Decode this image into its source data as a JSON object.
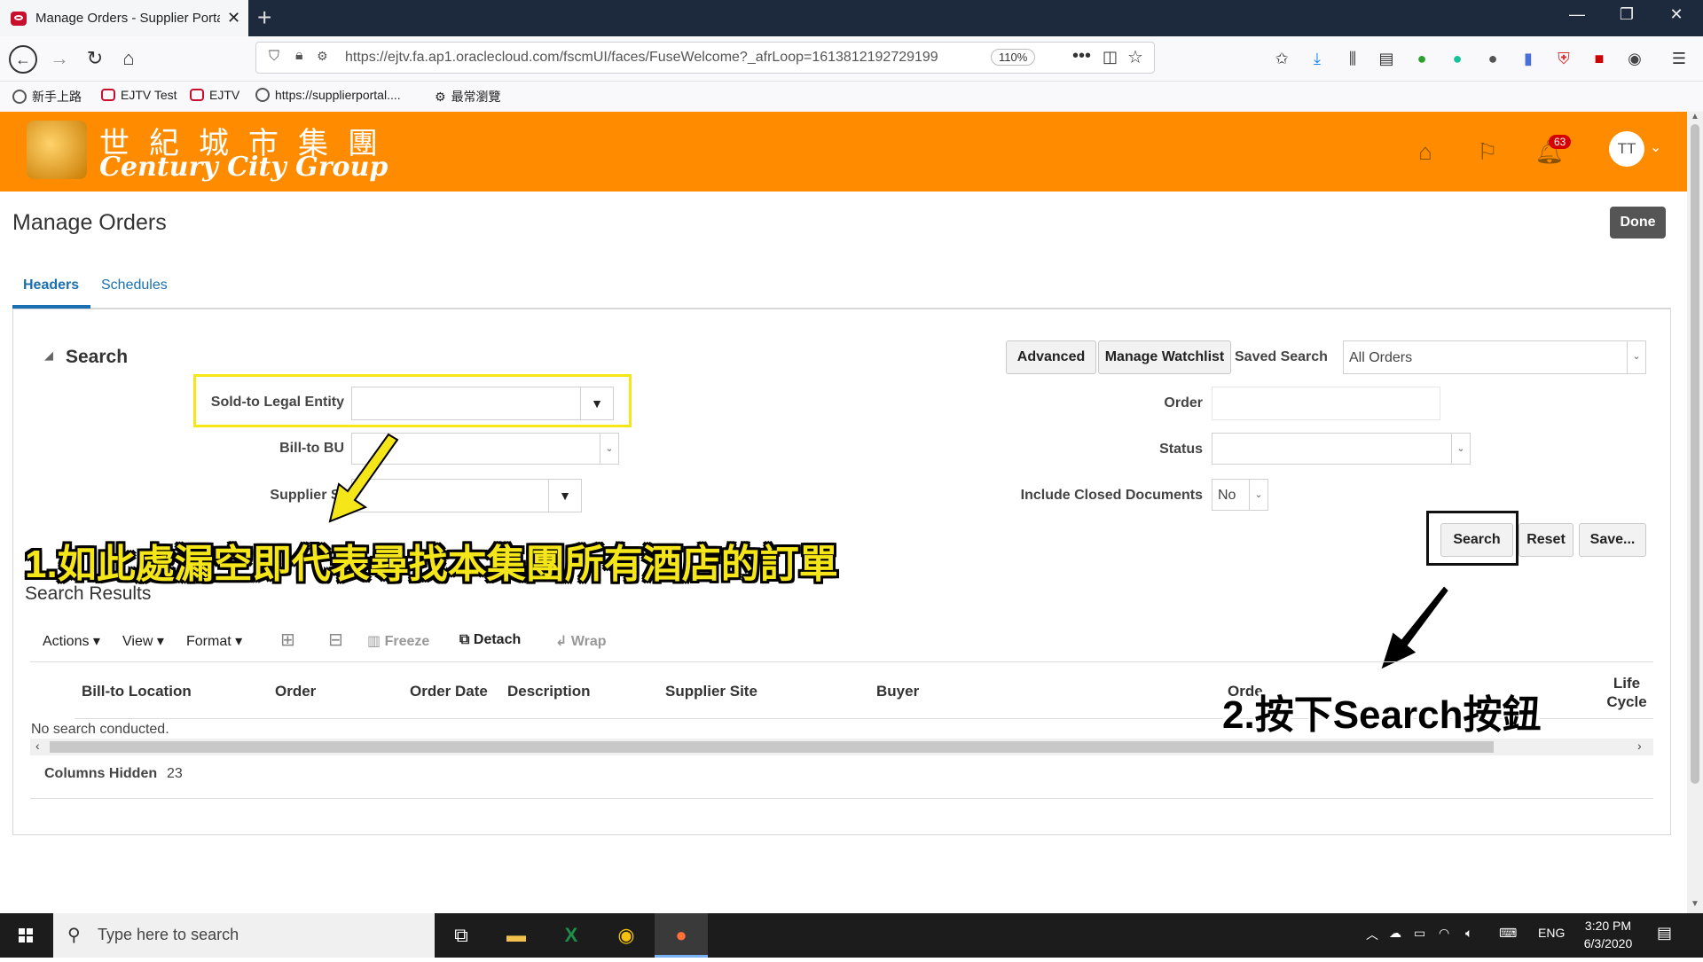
{
  "browser": {
    "tab_title": "Manage Orders - Supplier Porta",
    "url": "https://ejtv.fa.ap1.oraclecloud.com/fscmUI/faces/FuseWelcome?_afrLoop=1613812192729199",
    "zoom": "110%",
    "bookmarks": [
      {
        "label": "新手上路",
        "icon": "globe-icon"
      },
      {
        "label": "EJTV Test",
        "icon": "oracle-icon"
      },
      {
        "label": "EJTV",
        "icon": "oracle-icon"
      },
      {
        "label": "https://supplierportal....",
        "icon": "globe-icon"
      },
      {
        "label": "最常瀏覽",
        "icon": "gear-icon"
      }
    ]
  },
  "header": {
    "logo_cn": "世紀城市集團",
    "logo_en": "Century City Group",
    "notification_count": "63",
    "avatar_initials": "TT",
    "brand_color": "#ff8c00"
  },
  "page": {
    "title": "Manage Orders",
    "done_label": "Done",
    "tabs": [
      "Headers",
      "Schedules"
    ]
  },
  "search": {
    "section_label": "Search",
    "advanced_label": "Advanced",
    "watchlist_label": "Manage Watchlist",
    "saved_search_label": "Saved Search",
    "saved_search_value": "All Orders",
    "sold_to_label": "Sold-to Legal Entity",
    "bill_to_label": "Bill-to BU",
    "supplier_site_label": "Supplier Si",
    "order_label": "Order",
    "status_label": "Status",
    "include_closed_label": "Include Closed Documents",
    "include_closed_value": "No",
    "search_button": "Search",
    "reset_button": "Reset",
    "save_button": "Save..."
  },
  "results": {
    "title": "Search Results",
    "toolbar": {
      "actions": "Actions",
      "view": "View",
      "format": "Format",
      "freeze": "Freeze",
      "detach": "Detach",
      "wrap": "Wrap"
    },
    "columns": [
      "Bill-to Location",
      "Order",
      "Order Date",
      "Description",
      "Supplier Site",
      "Buyer",
      "Orde",
      "Life Cycle"
    ],
    "empty_text": "No search conducted.",
    "columns_hidden_label": "Columns Hidden",
    "columns_hidden_count": "23"
  },
  "annotations": {
    "step1": "1.如此處漏空即代表尋找本集團所有酒店的訂單",
    "step2": "2.按下Search按鈕"
  },
  "taskbar": {
    "search_placeholder": "Type here to search",
    "language": "ENG",
    "time": "3:20 PM",
    "date": "6/3/2020"
  }
}
